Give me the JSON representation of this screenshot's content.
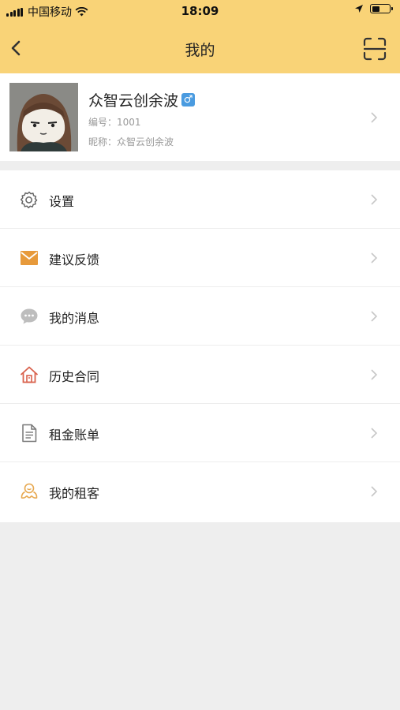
{
  "status_bar": {
    "carrier": "中国移动",
    "time": "18:09"
  },
  "nav": {
    "title": "我的",
    "back_icon": "back-arrow-icon",
    "scan_icon": "scan-icon"
  },
  "profile": {
    "name": "众智云创余波",
    "gender_symbol": "♂",
    "number_text": "编号：1001",
    "nickname_text": "昵称：众智云创余波"
  },
  "menu": {
    "items": [
      {
        "label": "设置",
        "icon": "gear-icon",
        "color": "#666666"
      },
      {
        "label": "建议反馈",
        "icon": "mail-icon",
        "color": "#e79a3b"
      },
      {
        "label": "我的消息",
        "icon": "chat-bubble-icon",
        "color": "#bdbdbd"
      },
      {
        "label": "历史合同",
        "icon": "house-icon",
        "color": "#d9614c"
      },
      {
        "label": "租金账单",
        "icon": "document-icon",
        "color": "#777777"
      },
      {
        "label": "我的租客",
        "icon": "tenant-icon",
        "color": "#e7a850"
      }
    ]
  },
  "colors": {
    "header_bg": "#f9d377",
    "page_bg": "#eeeeee",
    "gender_badge": "#4a9be0"
  }
}
